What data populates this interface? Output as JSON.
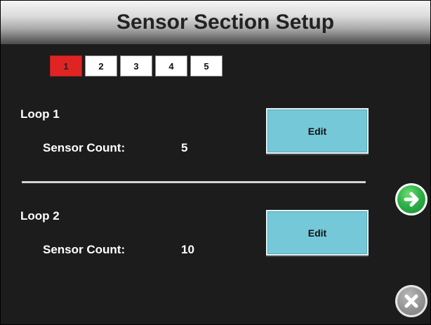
{
  "header": {
    "title": "Sensor Section Setup"
  },
  "tabs": [
    {
      "label": "1",
      "active": true
    },
    {
      "label": "2",
      "active": false
    },
    {
      "label": "3",
      "active": false
    },
    {
      "label": "4",
      "active": false
    },
    {
      "label": "5",
      "active": false
    }
  ],
  "loops": [
    {
      "label": "Loop 1",
      "count_label": "Sensor Count:",
      "count_value": "5",
      "edit_label": "Edit"
    },
    {
      "label": "Loop 2",
      "count_label": "Sensor Count:",
      "count_value": "10",
      "edit_label": "Edit"
    }
  ],
  "icons": {
    "next": "arrow-right-icon",
    "close": "close-x-icon"
  },
  "colors": {
    "active_tab": "#e02424",
    "edit_button": "#74c8d8",
    "next_button": "#2fb24a",
    "close_button": "#939393",
    "background": "#1c1c1c"
  }
}
